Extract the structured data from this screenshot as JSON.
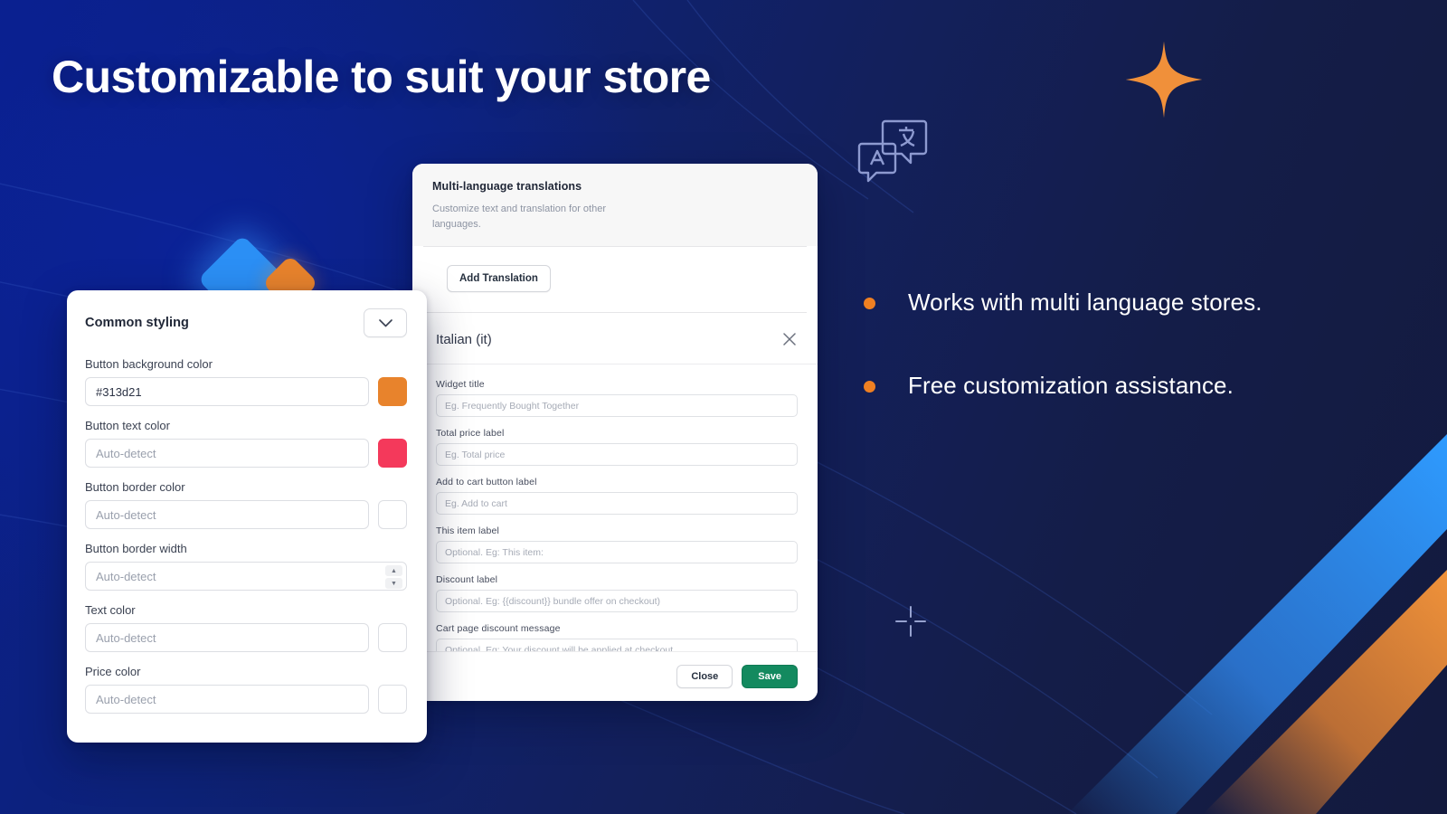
{
  "headline": "Customizable to suit your store",
  "colors": {
    "accent_orange": "#ef8022",
    "accent_blue": "#2b8ff5",
    "save_green": "#138a5f",
    "swatch_button_bg": "#e8832c",
    "swatch_button_text": "#f4395b",
    "background_deep_blue": "#0a1f8e",
    "background_navy": "#131a3e"
  },
  "bullets": [
    {
      "text": "Works with multi language stores."
    },
    {
      "text": "Free customization assistance."
    }
  ],
  "icons": {
    "translate": "translate-icon",
    "sparkle": "sparkle-icon",
    "crosshair": "crosshair-icon",
    "chevron_down": "chevron-down-icon",
    "close": "close-icon"
  },
  "styling_card": {
    "title": "Common styling",
    "collapse_label": "chevron-down-icon",
    "fields": [
      {
        "label": "Button background color",
        "value": "#313d21",
        "placeholder": "",
        "swatch": "#e8832c",
        "type": "color"
      },
      {
        "label": "Button text color",
        "value": "",
        "placeholder": "Auto-detect",
        "swatch": "#f4395b",
        "type": "color"
      },
      {
        "label": "Button border color",
        "value": "",
        "placeholder": "Auto-detect",
        "swatch": "#ffffff",
        "type": "color"
      },
      {
        "label": "Button border width",
        "value": "",
        "placeholder": "Auto-detect",
        "swatch": null,
        "type": "number"
      },
      {
        "label": "Text color",
        "value": "",
        "placeholder": "Auto-detect",
        "swatch": "#ffffff",
        "type": "color"
      },
      {
        "label": "Price color",
        "value": "",
        "placeholder": "Auto-detect",
        "swatch": "#ffffff",
        "type": "color"
      }
    ]
  },
  "translations_card": {
    "title": "Multi-language translations",
    "subtitle": "Customize text and translation for other languages.",
    "add_translation_label": "Add Translation",
    "language": "Italian (it)",
    "fields": [
      {
        "label": "Widget title",
        "placeholder": "Eg. Frequently Bought Together",
        "value": ""
      },
      {
        "label": "Total price label",
        "placeholder": "Eg. Total price",
        "value": ""
      },
      {
        "label": "Add to cart button label",
        "placeholder": "Eg. Add to cart",
        "value": ""
      },
      {
        "label": "This item label",
        "placeholder": "Optional. Eg: This item:",
        "value": ""
      },
      {
        "label": "Discount label",
        "placeholder": "Optional. Eg: {{discount}} bundle offer on checkout)",
        "value": ""
      },
      {
        "label": "Cart page discount message",
        "placeholder": "Optional. Eg: Your discount will be applied at checkout.",
        "value": ""
      }
    ],
    "close_label": "Close",
    "save_label": "Save"
  }
}
